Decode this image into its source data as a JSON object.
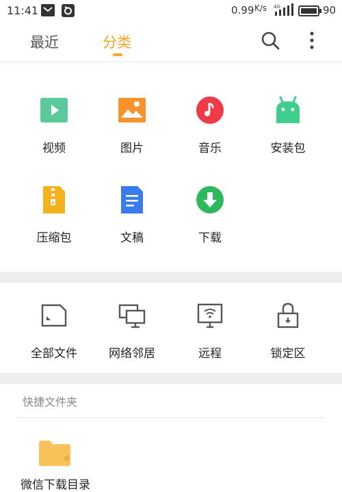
{
  "status_bar": {
    "time": "11:41",
    "net_speed": "0.99",
    "net_speed_unit": "K/s",
    "network_type": "4G",
    "battery": "90"
  },
  "header": {
    "tabs": [
      {
        "label": "最近",
        "active": false
      },
      {
        "label": "分类",
        "active": true
      }
    ],
    "accent_color": "#f5a623",
    "search_icon": "search-icon",
    "more_icon": "more-vert-icon"
  },
  "categories": [
    {
      "label": "视频",
      "icon": "video-icon",
      "color": "#5cc99a"
    },
    {
      "label": "图片",
      "icon": "image-icon",
      "color": "#f6932a"
    },
    {
      "label": "音乐",
      "icon": "music-icon",
      "color": "#ef3b48"
    },
    {
      "label": "安装包",
      "icon": "android-icon",
      "color": "#3ecf8e"
    },
    {
      "label": "压缩包",
      "icon": "zip-icon",
      "color": "#f6b21c"
    },
    {
      "label": "文稿",
      "icon": "document-icon",
      "color": "#3a7cf0"
    },
    {
      "label": "下载",
      "icon": "download-icon",
      "color": "#2db85c"
    }
  ],
  "storage": [
    {
      "label": "全部文件",
      "icon": "sd-card-icon"
    },
    {
      "label": "网络邻居",
      "icon": "network-icon"
    },
    {
      "label": "远程",
      "icon": "remote-icon"
    },
    {
      "label": "锁定区",
      "icon": "lock-icon"
    }
  ],
  "quick_folders": {
    "title": "快捷文件夹",
    "items": [
      {
        "label": "微信下载目录",
        "icon": "folder-icon",
        "color": "#f8c15a"
      }
    ]
  }
}
